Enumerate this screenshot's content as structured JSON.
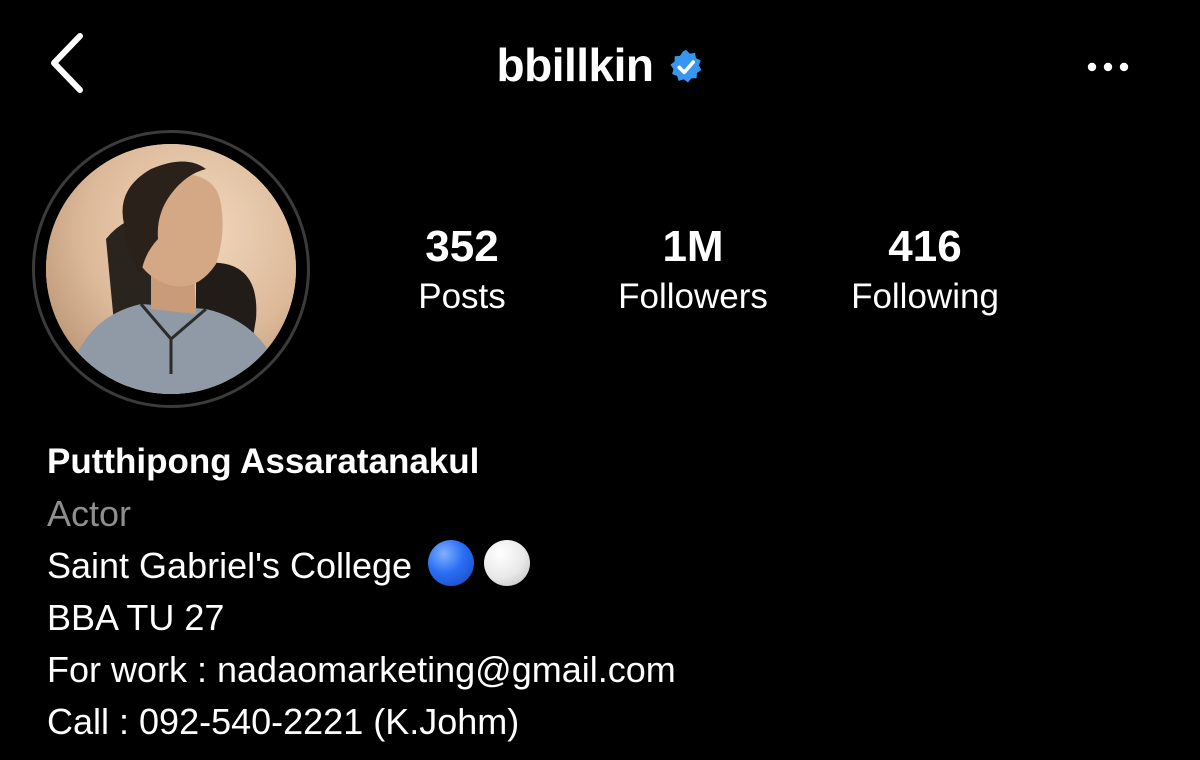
{
  "header": {
    "username": "bbillkin",
    "verified": true,
    "back_icon": "chevron-left-icon",
    "more_icon": "more-horizontal-icon"
  },
  "profile": {
    "avatar_icon": "profile-photo",
    "stats": {
      "posts": {
        "value": "352",
        "label": "Posts"
      },
      "followers": {
        "value": "1M",
        "label": "Followers"
      },
      "following": {
        "value": "416",
        "label": "Following"
      }
    }
  },
  "bio": {
    "name": "Putthipong Assaratanakul",
    "category": "Actor",
    "line1": "Saint Gabriel's College",
    "line2": "BBA TU 27",
    "line3": "For work : nadaomarketing@gmail.com",
    "line4": "Call : 092-540-2221 (K.Johm)"
  },
  "colors": {
    "background": "#000000",
    "text": "#ffffff",
    "secondary_text": "#8e8e8e",
    "verified_badge": "#3797f0"
  }
}
